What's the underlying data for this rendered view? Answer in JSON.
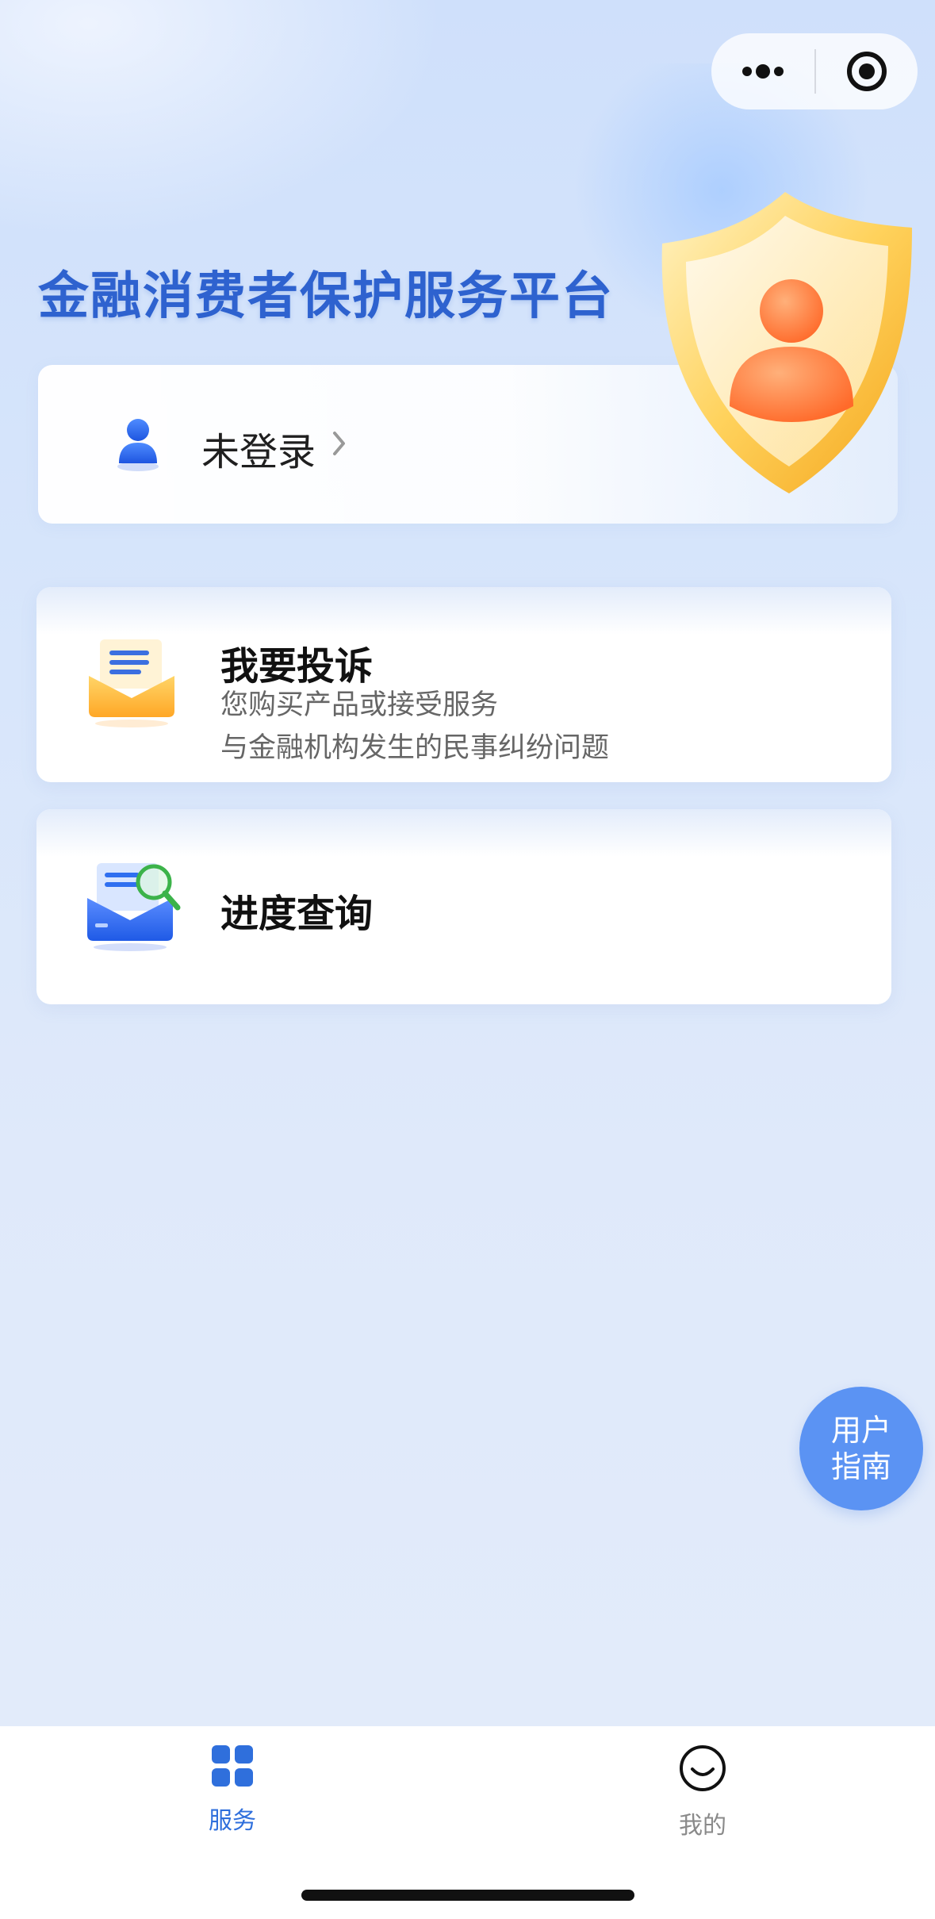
{
  "app": {
    "title": "金融消费者保护服务平台"
  },
  "capsule": {
    "more_icon": "more-dots-icon",
    "close_icon": "target-circle-icon"
  },
  "login": {
    "status": "未登录",
    "avatar_icon": "user-avatar-icon",
    "chevron_icon": "chevron-right-icon"
  },
  "cards": {
    "complaint": {
      "title": "我要投诉",
      "subtitle_line1": "您购买产品或接受服务",
      "subtitle_line2": "与金融机构发生的民事纠纷问题",
      "icon": "mail-document-icon"
    },
    "progress": {
      "title": "进度查询",
      "icon": "mail-search-icon"
    }
  },
  "guide": {
    "line1": "用户",
    "line2": "指南"
  },
  "tabbar": {
    "items": [
      {
        "label": "服务",
        "icon": "grid-apps-icon",
        "active": true
      },
      {
        "label": "我的",
        "icon": "smile-face-icon",
        "active": false
      }
    ]
  },
  "colors": {
    "accent": "#2f6fdc",
    "title": "#2e62cf",
    "guide_button": "#5b93f3",
    "complaint_icon": "#ffbe2e",
    "progress_icon": "#2f6ff0"
  }
}
